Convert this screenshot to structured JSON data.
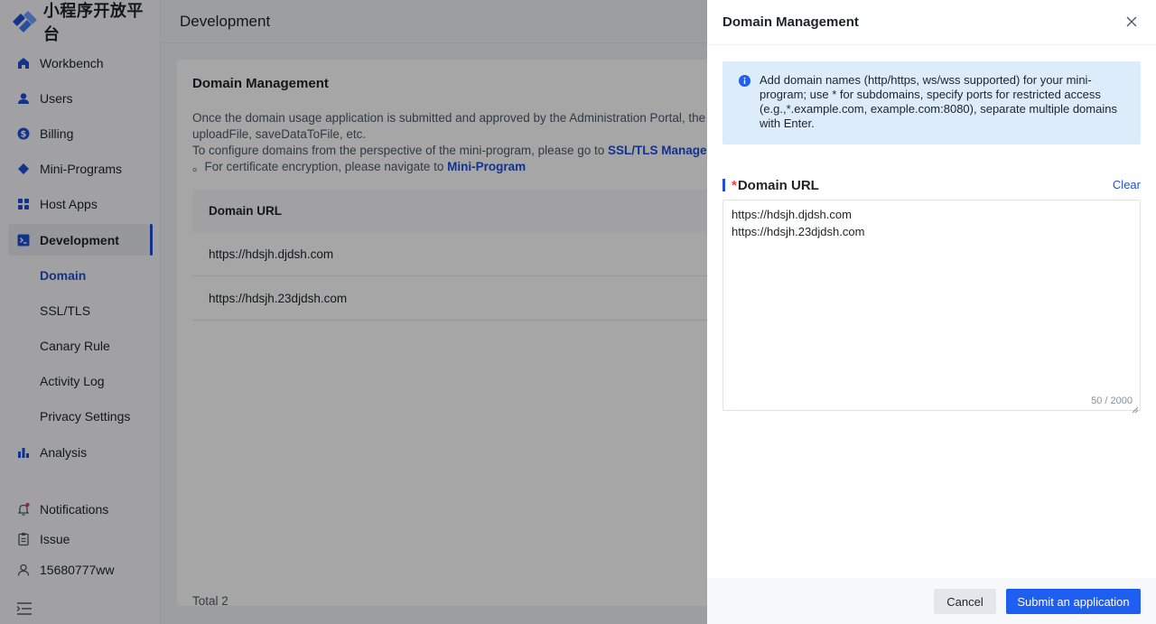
{
  "app": {
    "name": "小程序开放平台"
  },
  "sidebar": {
    "items": [
      {
        "label": "Workbench",
        "icon": "home-icon"
      },
      {
        "label": "Users",
        "icon": "user-icon"
      },
      {
        "label": "Billing",
        "icon": "dollar-icon"
      },
      {
        "label": "Mini-Programs",
        "icon": "diamond-icon"
      },
      {
        "label": "Host Apps",
        "icon": "grid-icon"
      },
      {
        "label": "Development",
        "icon": "terminal-icon",
        "active": true
      },
      {
        "label": "Analysis",
        "icon": "bar-chart-icon"
      }
    ],
    "sub_items": [
      {
        "label": "Domain",
        "active": true
      },
      {
        "label": "SSL/TLS"
      },
      {
        "label": "Canary Rule"
      },
      {
        "label": "Activity Log"
      },
      {
        "label": "Privacy Settings"
      }
    ],
    "bottom": [
      {
        "label": "Notifications",
        "icon": "bell-icon"
      },
      {
        "label": "Issue",
        "icon": "clipboard-icon"
      },
      {
        "label": "15680777ww",
        "icon": "person-icon"
      }
    ]
  },
  "header": {
    "title": "Development"
  },
  "main": {
    "title": "Domain Management",
    "desc_line1": "Once the domain usage application is submitted and approved by the Administration Portal, the m",
    "desc_line2": "uploadFile, saveDataToFile, etc.",
    "desc_line3_prefix": "To configure domains from the perspective of the mini-program, please go to ",
    "desc_line3_link": "SSL/TLS Managem",
    "desc_line4_prefix": "。For certificate encryption, please navigate to ",
    "desc_line4_link": "Mini-Program",
    "table": {
      "header": "Domain URL",
      "rows": [
        "https://hdsjh.djdsh.com",
        "https://hdsjh.23djdsh.com"
      ]
    },
    "total": "Total 2"
  },
  "drawer": {
    "title": "Domain Management",
    "info": "Add domain names (http/https, ws/wss supported) for your mini-program; use * for subdomains, specify ports for restricted access (e.g.,*.example.com, example.com:8080), separate multiple domains with Enter.",
    "field_required": "*",
    "field_label": "Domain URL",
    "clear_label": "Clear",
    "textarea_value": "https://hdsjh.djdsh.com\nhttps://hdsjh.23djdsh.com",
    "counter": "50 / 2000",
    "cancel_label": "Cancel",
    "submit_label": "Submit an application"
  },
  "colors": {
    "accent": "#1e4fd6",
    "primary_button": "#1e5ef0",
    "info_bg": "#dcecfb",
    "required": "#f53f3f"
  }
}
